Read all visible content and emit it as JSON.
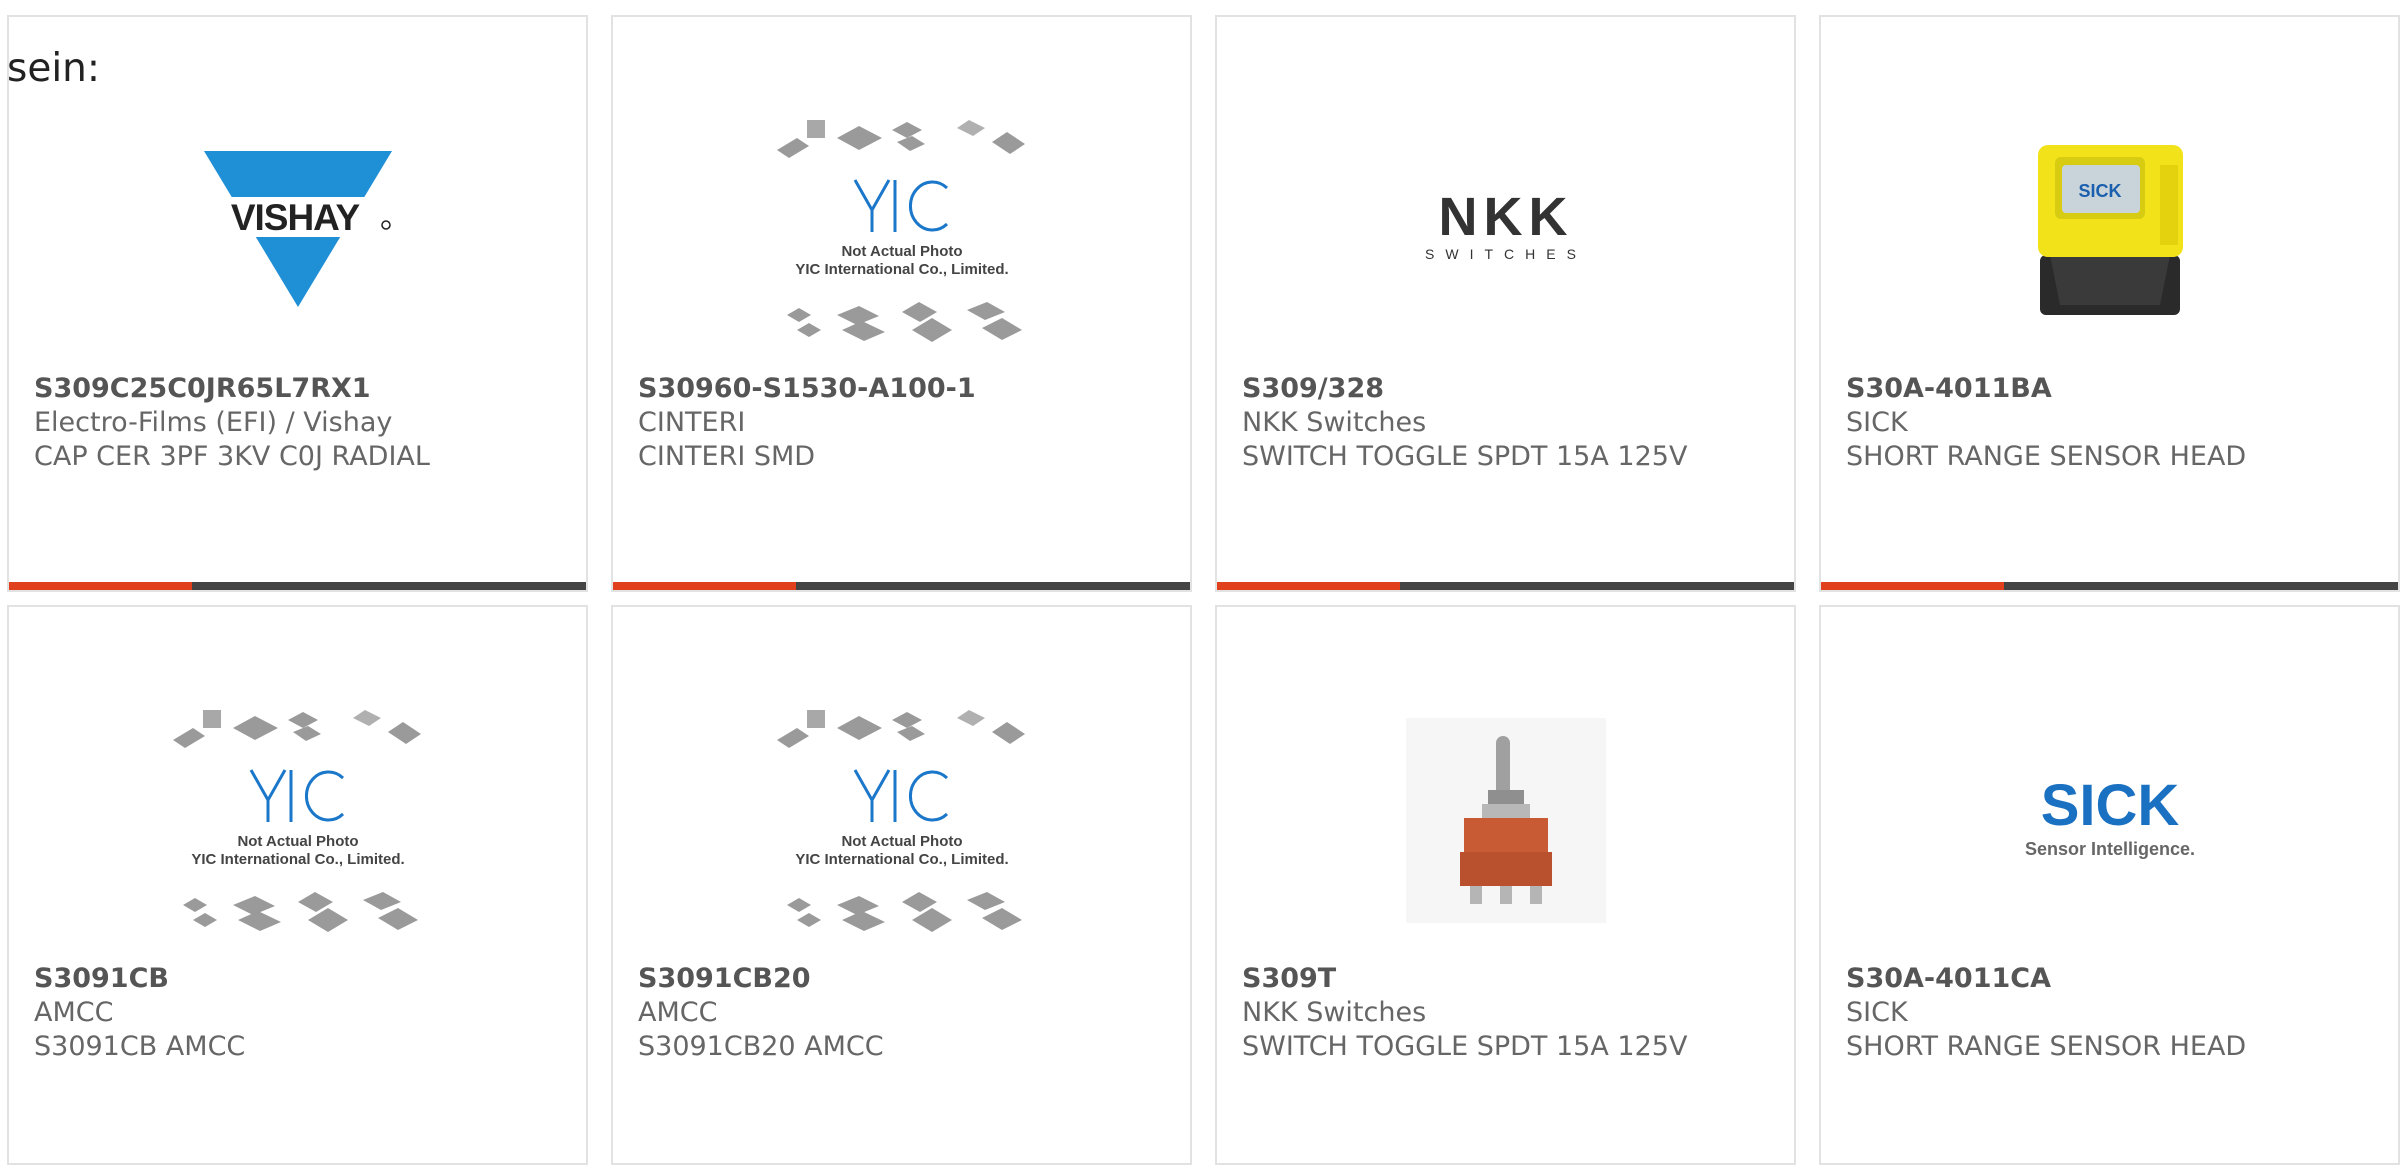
{
  "lead_text": "sein:",
  "colors": {
    "accent": "#e0401c",
    "bar": "#444444",
    "border": "#e2e2e2"
  },
  "cards": [
    {
      "part_number": "S309C25C0JR65L7RX1",
      "manufacturer": "Electro-Films (EFI) / Vishay",
      "description": "CAP CER 3PF 3KV C0J RADIAL",
      "logo": "vishay-logo",
      "logo_text": "VISHAY"
    },
    {
      "part_number": "S30960-S1530-A100-1",
      "manufacturer": "CINTERI",
      "description": "CINTERI SMD",
      "logo": "yic-placeholder",
      "logo_text": "YIC",
      "caption_line1": "Not Actual Photo",
      "caption_line2": "YIC International Co., Limited."
    },
    {
      "part_number": "S309/328",
      "manufacturer": "NKK Switches",
      "description": "SWITCH TOGGLE SPDT 15A 125V",
      "logo": "nkk-logo",
      "logo_text": "NKK",
      "logo_subtext": "SWITCHES"
    },
    {
      "part_number": "S30A-4011BA",
      "manufacturer": "SICK",
      "description": "SHORT RANGE SENSOR HEAD",
      "logo": "sick-sensor-photo",
      "logo_text": "SICK"
    },
    {
      "part_number": "S3091CB",
      "manufacturer": "AMCC",
      "description": "S3091CB AMCC",
      "logo": "yic-placeholder",
      "logo_text": "YIC",
      "caption_line1": "Not Actual Photo",
      "caption_line2": "YIC International Co., Limited."
    },
    {
      "part_number": "S3091CB20",
      "manufacturer": "AMCC",
      "description": "S3091CB20 AMCC",
      "logo": "yic-placeholder",
      "logo_text": "YIC",
      "caption_line1": "Not Actual Photo",
      "caption_line2": "YIC International Co., Limited."
    },
    {
      "part_number": "S309T",
      "manufacturer": "NKK Switches",
      "description": "SWITCH TOGGLE SPDT 15A 125V",
      "logo": "toggle-switch-photo"
    },
    {
      "part_number": "S30A-4011CA",
      "manufacturer": "SICK",
      "description": "SHORT RANGE SENSOR HEAD",
      "logo": "sick-logo",
      "logo_text": "SICK",
      "logo_subtext": "Sensor Intelligence."
    }
  ]
}
